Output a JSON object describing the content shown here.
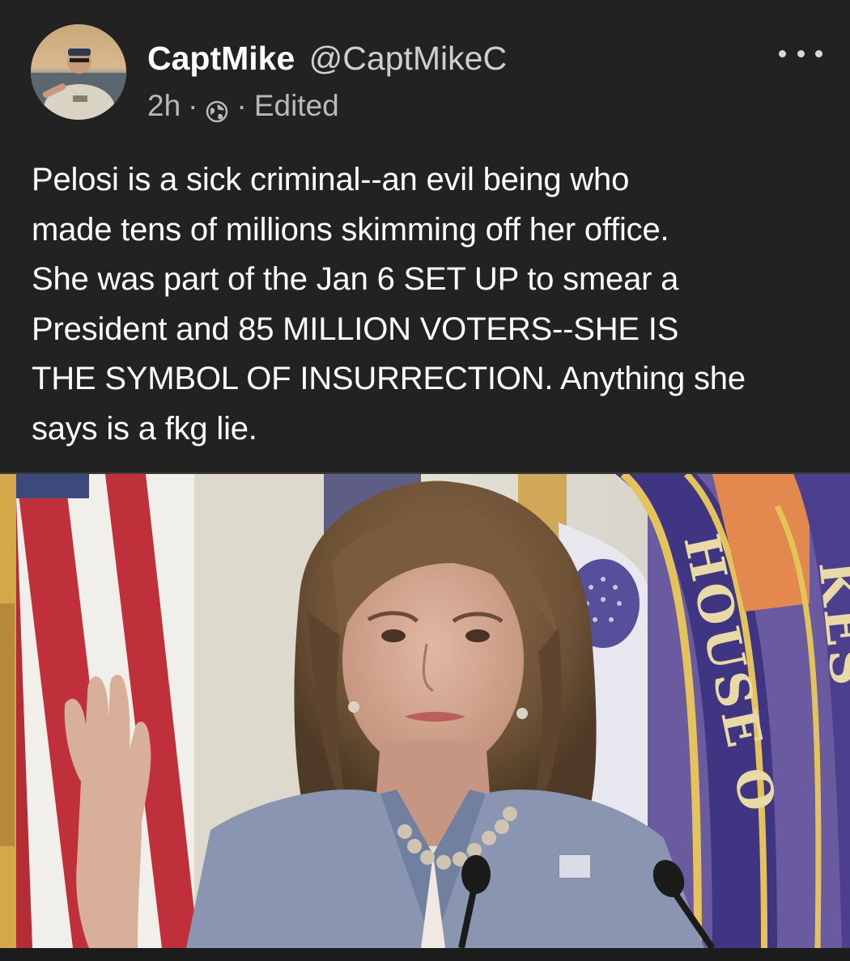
{
  "post": {
    "author": {
      "display_name": "CaptMike",
      "handle": "@CaptMikeC",
      "avatar_icon": "user-avatar-photo"
    },
    "meta": {
      "time": "2h",
      "separator": "·",
      "visibility_icon": "globe-icon",
      "edited_label": "Edited"
    },
    "more_icon": "more-horizontal-icon",
    "text_lines": [
      "Pelosi is a sick criminal--an evil being who",
      "made tens of millions skimming off her office.",
      "She was part of the Jan 6 SET UP to smear a",
      "President and 85 MILLION VOTERS--SHE IS",
      "THE SYMBOL OF INSURRECTION. Anything she",
      "says is a fkg lie."
    ],
    "media": {
      "seal_letters_left": "HOUSE O",
      "seal_letters_right": "KES"
    }
  },
  "colors": {
    "background": "#222222",
    "text_primary": "#ffffff",
    "text_secondary": "#b9b9b9",
    "divider": "#3a3a3a"
  }
}
